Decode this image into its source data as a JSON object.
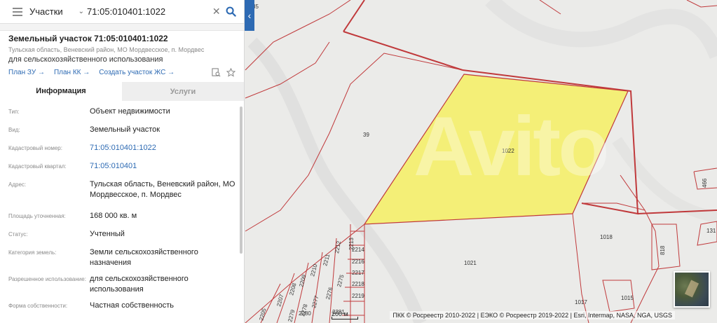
{
  "search": {
    "type_label": "Участки",
    "value": "71:05:010401:1022"
  },
  "object": {
    "title": "Земельный участок 71:05:010401:1022",
    "address_short": "Тульская область, Веневский район, МО Мордвесское, п. Мордвес",
    "usage": "для сельскохозяйственного использования"
  },
  "links": [
    {
      "label": "План ЗУ →"
    },
    {
      "label": "План КК →"
    },
    {
      "label": "Создать участок ЖС →"
    }
  ],
  "tabs": [
    {
      "label": "Информация",
      "active": true
    },
    {
      "label": "Услуги",
      "active": false
    }
  ],
  "info": [
    {
      "key": "Тип:",
      "value": "Объект недвижимости"
    },
    {
      "key": "Вид:",
      "value": "Земельный участок"
    },
    {
      "key": "Кадастровый номер:",
      "value": "71:05:010401:1022"
    },
    {
      "key": "Кадастровый квартал:",
      "value": "71:05:010401"
    },
    {
      "key": "Адрес:",
      "value": "Тульская область, Веневский район, МО Мордвесское, п. Мордвес"
    },
    {
      "key": "Площадь уточненная:",
      "value": "168 000 кв. м"
    },
    {
      "key": "Статус:",
      "value": "Учтенный"
    },
    {
      "key": "Категория земель:",
      "value": "Земли сельскохозяйственного назначения"
    },
    {
      "key": "Разрешенное использование:",
      "value": "для сельскохозяйственного использования"
    },
    {
      "key": "Форма собственности:",
      "value": "Частная собственность"
    }
  ],
  "map": {
    "plot_labels": {
      "p35": "35",
      "p39": "39",
      "p1022": "1022",
      "p1021": "1021",
      "p1018": "1018",
      "p1017": "1017",
      "p1015": "1015",
      "p466": "466",
      "p131": "131",
      "p818": "818",
      "p2213": "2213",
      "p2212": "2212",
      "p2214": "2214",
      "p2216": "2216",
      "p2217": "2217",
      "p2218": "2218",
      "p2219": "2219",
      "p2211": "2211",
      "p2210": "2210",
      "p2209": "2209",
      "p2208": "2208",
      "p2207": "2207",
      "p2205": "2205",
      "p2275": "2275",
      "p2276": "2276",
      "p2277": "2277",
      "p2278": "2278",
      "p2279": "2279",
      "p2280": "2280",
      "p2281": "2281"
    },
    "scale": "200 м",
    "attribution": "ПКК © Росреестр 2010-2022 | ЕЭКО © Росреестр 2019-2022 | Esri, Intermap, NASA, NGA, USGS",
    "watermark": "Avito",
    "selected_fill": "#f5f06a",
    "boundary_color": "#c0393b"
  },
  "colors": {
    "accent": "#2d6ab3",
    "tab_inactive_bg": "#eeeeee"
  }
}
